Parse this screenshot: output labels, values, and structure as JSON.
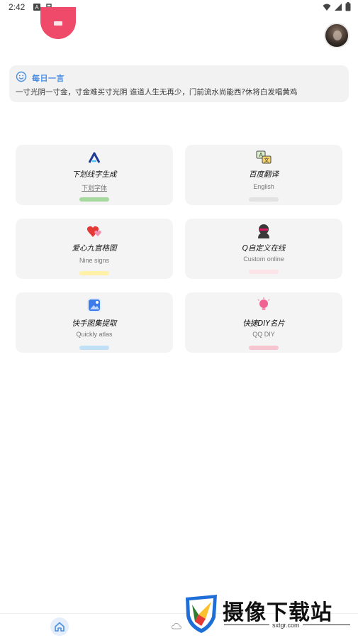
{
  "status_bar": {
    "time": "2:42"
  },
  "daily_quote": {
    "title": "每日一言",
    "text": "一寸光阴一寸金，寸金难买寸光阴  谁道人生无再少，门前流水尚能西?休将白发唱黄鸡"
  },
  "features": [
    {
      "title": "下划线字生成",
      "subtitle": "下划字体",
      "icon": "triangle-logo-icon",
      "accent": "#a7d8a0"
    },
    {
      "title": "百度翻译",
      "subtitle": "English",
      "icon": "translate-icon",
      "accent": "#e2e2e2"
    },
    {
      "title": "爱心九宫格图",
      "subtitle": "Nine signs",
      "icon": "hearts-icon",
      "accent": "#fff1a8"
    },
    {
      "title": "Q自定义在线",
      "subtitle": "Custom online",
      "icon": "ninja-icon",
      "accent": "#fbe3e8"
    },
    {
      "title": "快手图集提取",
      "subtitle": "Quickly atlas",
      "icon": "gallery-icon",
      "accent": "#bfe0f7"
    },
    {
      "title": "快捷DIY名片",
      "subtitle": "QQ DIY",
      "icon": "lightbulb-icon",
      "accent": "#f7c5d0"
    }
  ],
  "bottom_nav": {
    "items": [
      {
        "icon": "home-icon",
        "active": true
      },
      {
        "icon": "cloud-icon",
        "active": false
      }
    ]
  },
  "watermark": {
    "brand": "摄像下载站",
    "url": "sxtgr.com"
  },
  "colors": {
    "accent_blue": "#4a8fe3",
    "pink": "#ef4a6a",
    "card_bg": "#f4f4f4"
  }
}
